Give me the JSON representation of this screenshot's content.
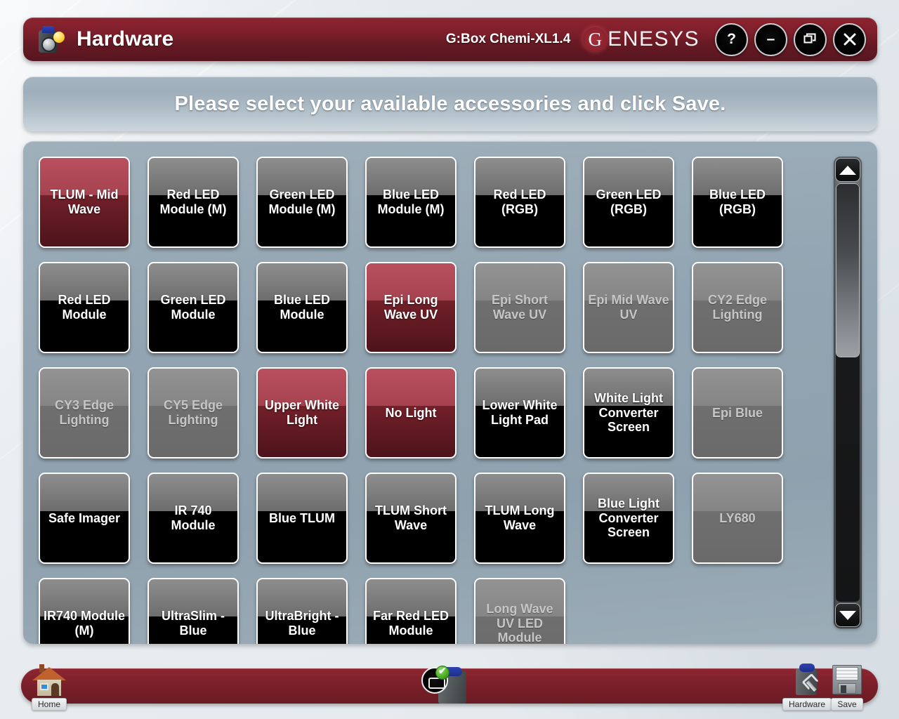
{
  "titlebar": {
    "app_title": "Hardware",
    "icon": "hardware-device-icon",
    "model": "G:Box Chemi-XL1.4",
    "logo_first": "G",
    "logo_rest": "ENESYS",
    "buttons": [
      {
        "name": "help-button",
        "glyph": "?"
      },
      {
        "name": "minimize-button",
        "glyph": "–"
      },
      {
        "name": "restore-button",
        "glyph": "restore"
      },
      {
        "name": "close-button",
        "glyph": "✕"
      }
    ]
  },
  "banner": {
    "message": "Please select your available accessories and click Save."
  },
  "accessories": [
    {
      "label": "TLUM - Mid Wave",
      "state": "on"
    },
    {
      "label": "Red LED Module (M)",
      "state": "off"
    },
    {
      "label": "Green LED Module (M)",
      "state": "off"
    },
    {
      "label": "Blue LED Module (M)",
      "state": "off"
    },
    {
      "label": "Red LED (RGB)",
      "state": "off"
    },
    {
      "label": "Green LED (RGB)",
      "state": "off"
    },
    {
      "label": "Blue LED (RGB)",
      "state": "off"
    },
    {
      "label": "Red LED Module",
      "state": "off"
    },
    {
      "label": "Green LED Module",
      "state": "off"
    },
    {
      "label": "Blue LED Module",
      "state": "off"
    },
    {
      "label": "Epi Long Wave UV",
      "state": "on"
    },
    {
      "label": "Epi Short Wave UV",
      "state": "disabled"
    },
    {
      "label": "Epi Mid Wave UV",
      "state": "disabled"
    },
    {
      "label": "CY2 Edge Lighting",
      "state": "disabled"
    },
    {
      "label": "CY3 Edge Lighting",
      "state": "disabled"
    },
    {
      "label": "CY5 Edge Lighting",
      "state": "disabled"
    },
    {
      "label": "Upper White Light",
      "state": "on"
    },
    {
      "label": "No Light",
      "state": "on"
    },
    {
      "label": "Lower White Light Pad",
      "state": "off"
    },
    {
      "label": "White Light Converter Screen",
      "state": "off"
    },
    {
      "label": "Epi Blue",
      "state": "disabled"
    },
    {
      "label": "Safe Imager",
      "state": "off"
    },
    {
      "label": "IR 740 Module",
      "state": "off"
    },
    {
      "label": "Blue TLUM",
      "state": "off"
    },
    {
      "label": "TLUM Short Wave",
      "state": "off"
    },
    {
      "label": "TLUM Long Wave",
      "state": "off"
    },
    {
      "label": "Blue Light Converter Screen",
      "state": "off"
    },
    {
      "label": "LY680",
      "state": "disabled"
    },
    {
      "label": "IR740 Module (M)",
      "state": "off"
    },
    {
      "label": "UltraSlim - Blue",
      "state": "off"
    },
    {
      "label": "UltraBright - Blue",
      "state": "off"
    },
    {
      "label": "Far Red LED Module",
      "state": "off"
    },
    {
      "label": "Long Wave UV LED Module",
      "state": "disabled"
    }
  ],
  "scrollbar": {
    "up_arrow": "scroll-up-arrow",
    "down_arrow": "scroll-down-arrow",
    "thumb_position_percent": 0
  },
  "taskbar": {
    "items": [
      {
        "name": "home",
        "label": "Home",
        "icon": "house-icon"
      },
      {
        "name": "capture",
        "label": "",
        "icon": "camera-check-icon"
      },
      {
        "name": "hardware",
        "label": "Hardware",
        "icon": "hardware-wrench-icon"
      },
      {
        "name": "save",
        "label": "Save",
        "icon": "floppy-disk-icon"
      }
    ]
  },
  "colors": {
    "titlebar_red": "#7d1f2b",
    "selected_red": "#a6424f",
    "panel_blue_grey": "#93a5b2",
    "page_background": "#dfe5ea"
  }
}
